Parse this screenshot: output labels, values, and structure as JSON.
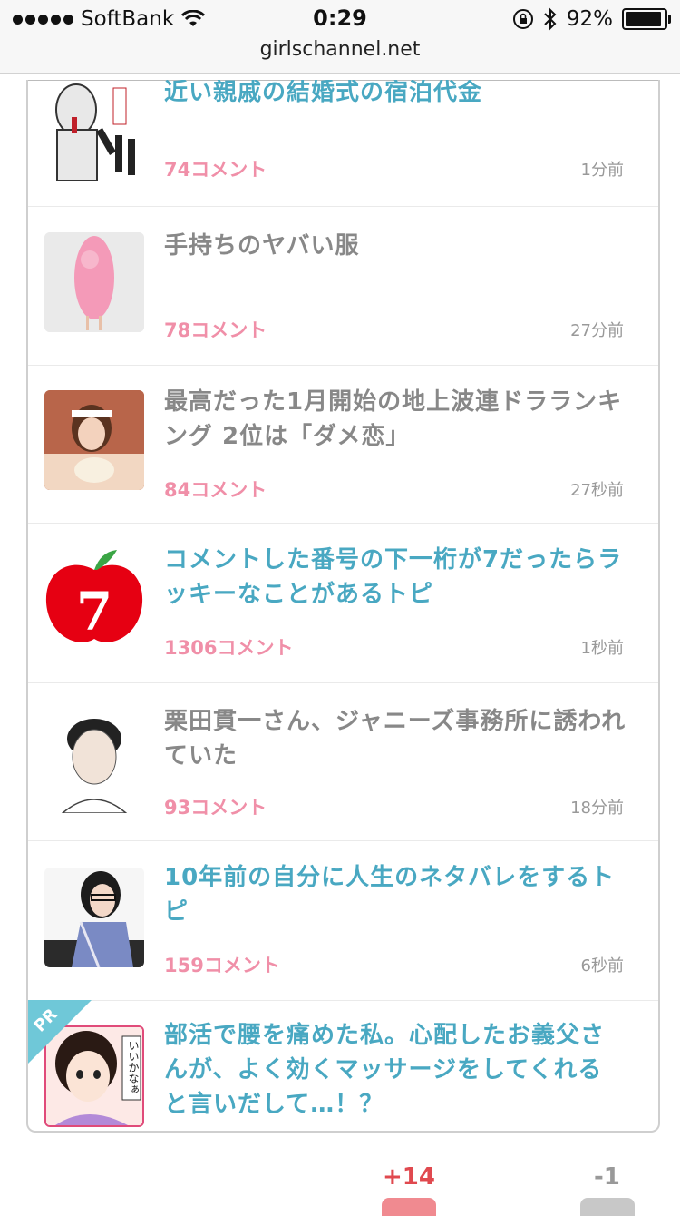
{
  "status_bar": {
    "carrier": "SoftBank",
    "time": "0:29",
    "battery": "92%",
    "battery_level": 0.92
  },
  "address_bar": {
    "url": "girlschannel.net"
  },
  "topics": [
    {
      "title": "近い親戚の結婚式の宿泊代金",
      "title_color": "teal",
      "comments": "74コメント",
      "time": "1分前",
      "thumb": "microphone-press-illustration"
    },
    {
      "title": "手持ちのヤバい服",
      "title_color": "gray",
      "comments": "78コメント",
      "time": "27分前",
      "thumb": "pink-feather-dress"
    },
    {
      "title": "最高だった1月開始の地上波連ドラランキング 2位は「ダメ恋」",
      "title_color": "gray",
      "comments": "84コメント",
      "time": "27秒前",
      "thumb": "actress-photo"
    },
    {
      "title": "コメントした番号の下一桁が7だったらラッキーなことがあるトピ",
      "title_color": "teal",
      "comments": "1306コメント",
      "time": "1秒前",
      "thumb": "red-apple-seven"
    },
    {
      "title": "栗田貫一さん、ジャニーズ事務所に誘われていた",
      "title_color": "gray",
      "comments": "93コメント",
      "time": "18分前",
      "thumb": "man-portrait"
    },
    {
      "title": "10年前の自分に人生のネタバレをするトピ",
      "title_color": "teal",
      "comments": "159コメント",
      "time": "6秒前",
      "thumb": "woman-portrait"
    }
  ],
  "ad": {
    "badge": "PR",
    "title": "部活で腰を痛めた私。心配したお義父さんが、よく効くマッサージをしてくれると言いだして…！？",
    "thumb_text": "いいかなぁ"
  },
  "footer": {
    "plus": "+14",
    "minus": "-1"
  }
}
